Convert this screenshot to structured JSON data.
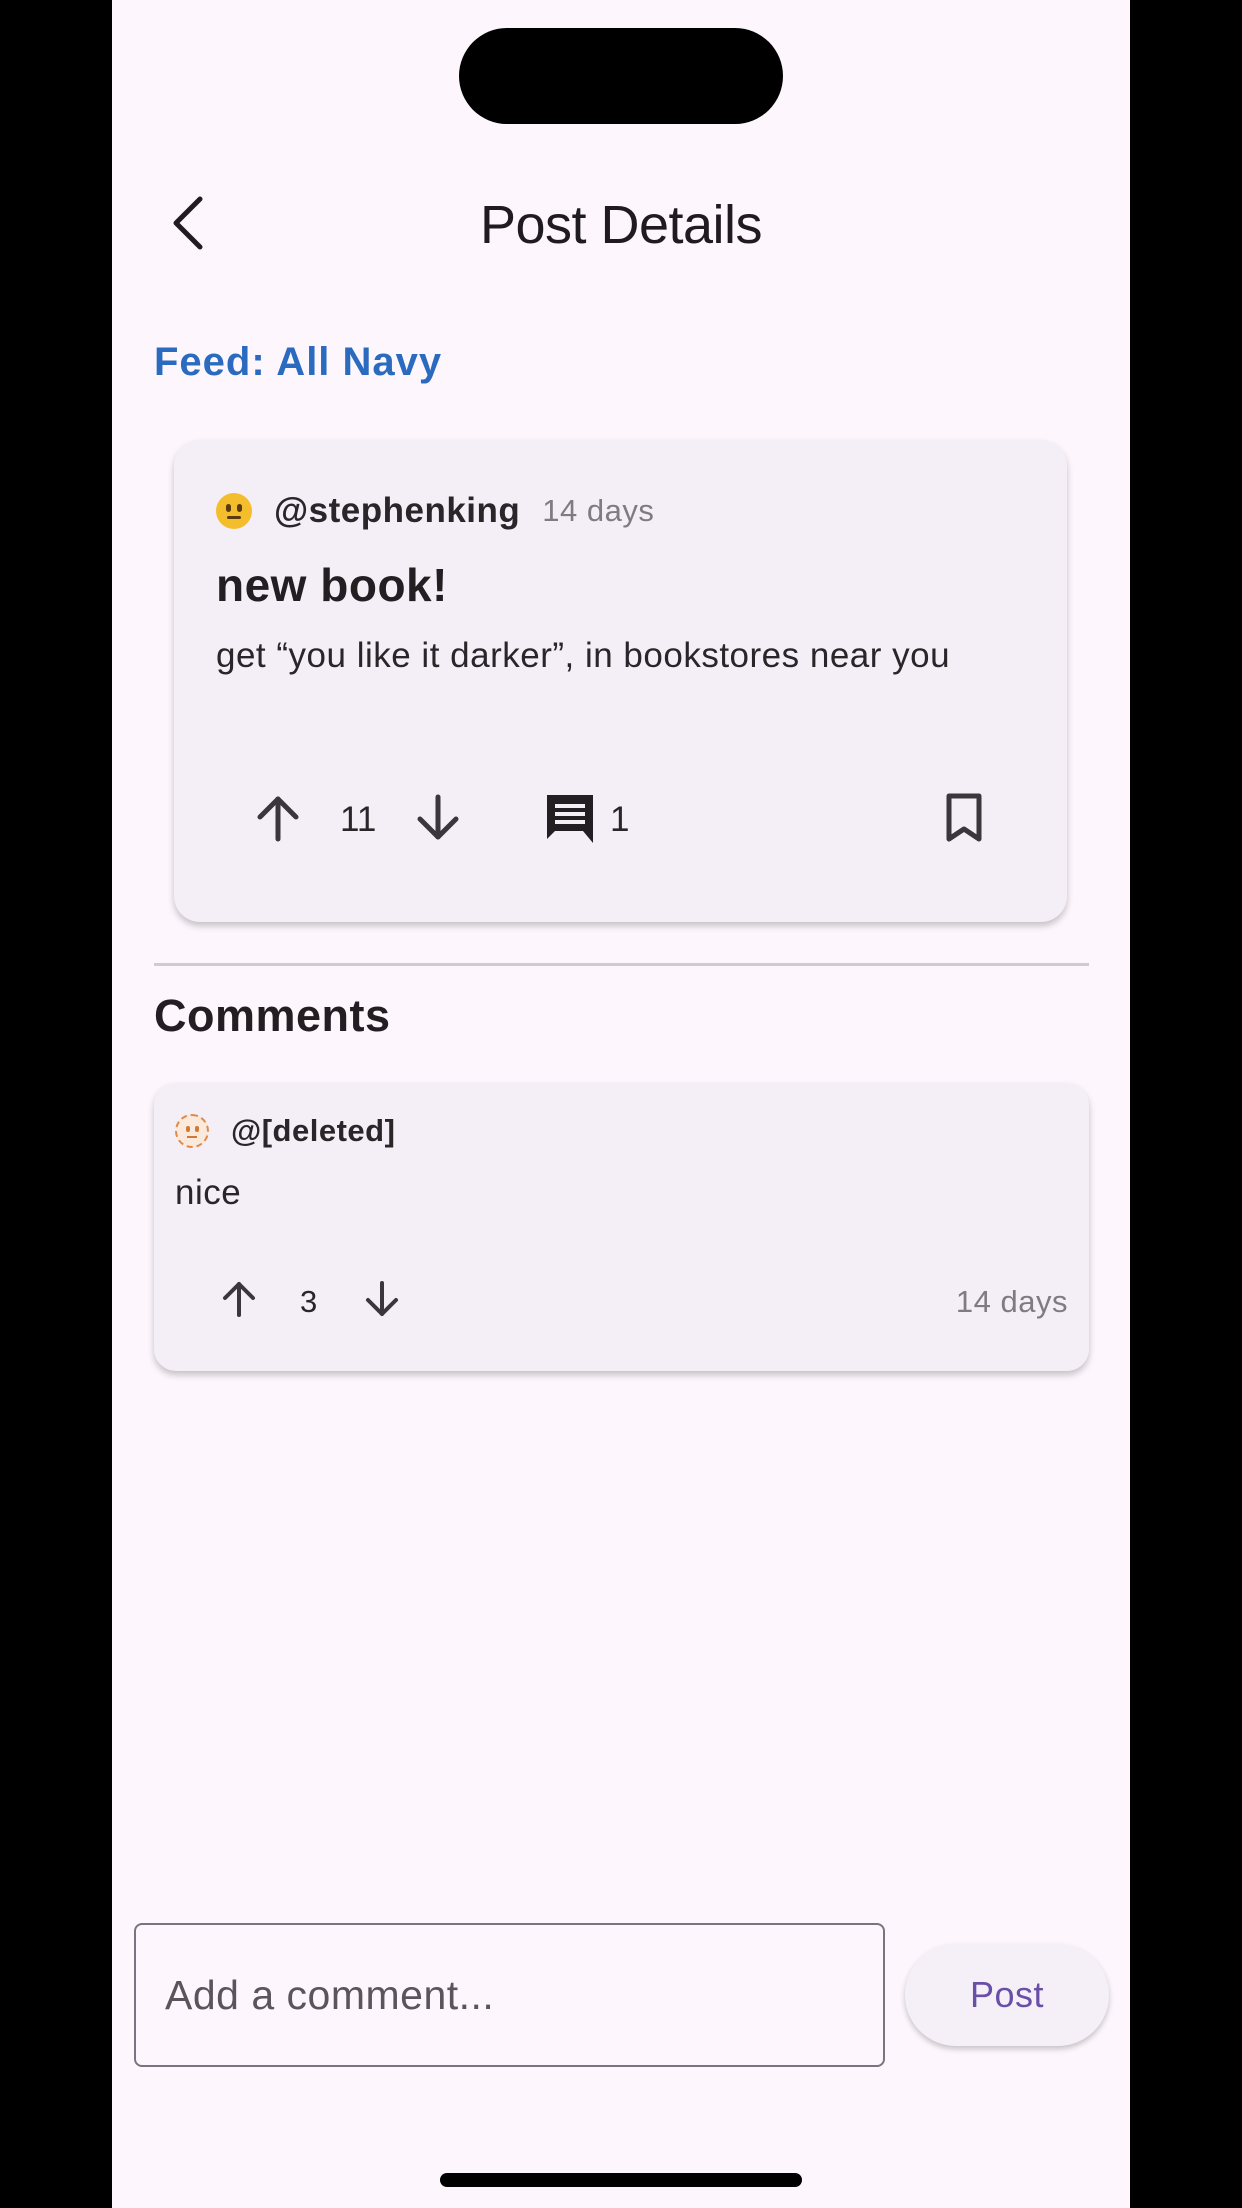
{
  "header": {
    "title": "Post Details"
  },
  "feed": {
    "label": "Feed: All Navy"
  },
  "post": {
    "author": "@stephenking",
    "avatar_icon": "neutral-face-emoji-icon",
    "time": "14 days",
    "title": "new book!",
    "body": "get “you like it darker”, in bookstores near you",
    "score": "11",
    "comment_count": "1"
  },
  "comments": {
    "heading": "Comments",
    "items": [
      {
        "author": "@[deleted]",
        "avatar_icon": "dotted-neutral-face-emoji-icon",
        "text": "nice",
        "score": "3",
        "time": "14 days"
      }
    ]
  },
  "composer": {
    "placeholder": "Add a comment...",
    "submit_label": "Post"
  },
  "colors": {
    "background": "#fdf7fd",
    "card": "#f4eff6",
    "feed_link": "#2a6bbf",
    "accent": "#6a4fa8"
  }
}
